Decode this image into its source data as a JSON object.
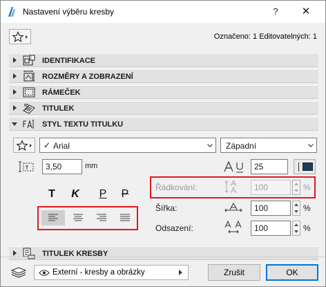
{
  "window": {
    "title": "Nastavení výběru kresby",
    "help": "?",
    "close": "✕"
  },
  "header": {
    "selected_info": "Označeno: 1 Editovatelných: 1"
  },
  "panels": [
    {
      "label": "IDENTIFIKACE",
      "icon": "identification-icon",
      "expanded": false
    },
    {
      "label": "ROZMĚRY A ZOBRAZENÍ",
      "icon": "dimensions-icon",
      "expanded": false
    },
    {
      "label": "RÁMEČEK",
      "icon": "frame-icon",
      "expanded": false
    },
    {
      "label": "TITULEK",
      "icon": "title-icon",
      "expanded": false
    },
    {
      "label": "STYL TEXTU TITULKU",
      "icon": "text-style-icon",
      "expanded": true
    },
    {
      "label": "TITULEK KRESBY",
      "icon": "drawing-title-icon",
      "expanded": false
    }
  ],
  "text_style": {
    "font_checked": "✓",
    "font": "Arial",
    "script": "Západní",
    "size_value": "3,50",
    "size_unit": "mm",
    "pen_value": "25",
    "style_buttons": [
      "T",
      "K",
      "P",
      "P"
    ],
    "alignment_active": "left",
    "line_spacing_label": "Řádkování:",
    "line_spacing_value": "100",
    "line_spacing_unit": "%",
    "width_label": "Šířka:",
    "width_value": "100",
    "width_unit": "%",
    "spacing_label": "Odsazení:",
    "spacing_value": "100",
    "spacing_unit": "%",
    "pen_color": "#1f3b5a"
  },
  "footer": {
    "layer": "Externí - kresby a obrázky",
    "cancel": "Zrušit",
    "ok": "OK"
  },
  "colors": {
    "highlight_red": "#e0191f",
    "panel_bg": "#e2e2e2",
    "ok_border": "#0078d7"
  }
}
